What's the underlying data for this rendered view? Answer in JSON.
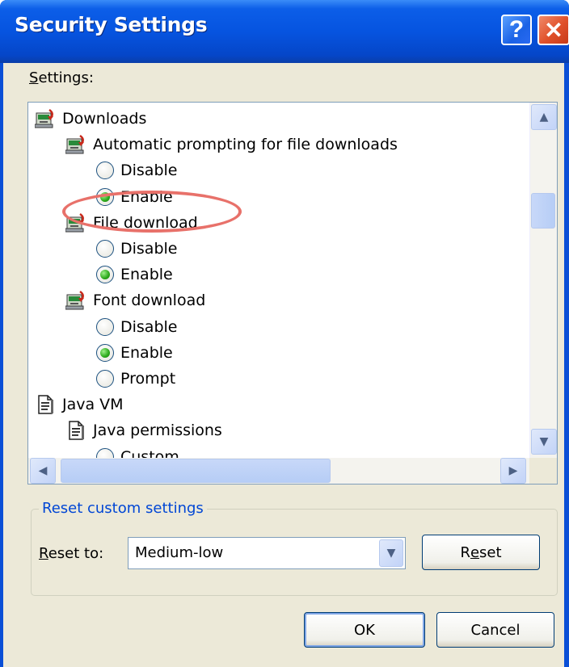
{
  "window": {
    "title": "Security Settings",
    "help_glyph": "?",
    "close_glyph": "✕",
    "accent": "#0a4fd6"
  },
  "settings": {
    "label_first": "S",
    "label_rest": "ettings:",
    "tree": [
      {
        "kind": "category",
        "level": 0,
        "icon": "downloads-icon",
        "label": "Downloads"
      },
      {
        "kind": "category",
        "level": 1,
        "icon": "downloads-icon",
        "label": "Automatic prompting for file downloads"
      },
      {
        "kind": "option",
        "level": 2,
        "label": "Disable",
        "checked": false
      },
      {
        "kind": "option",
        "level": 2,
        "label": "Enable",
        "checked": true
      },
      {
        "kind": "category",
        "level": 1,
        "icon": "downloads-icon",
        "label": "File download"
      },
      {
        "kind": "option",
        "level": 2,
        "label": "Disable",
        "checked": false
      },
      {
        "kind": "option",
        "level": 2,
        "label": "Enable",
        "checked": true
      },
      {
        "kind": "category",
        "level": 1,
        "icon": "downloads-icon",
        "label": "Font download"
      },
      {
        "kind": "option",
        "level": 2,
        "label": "Disable",
        "checked": false
      },
      {
        "kind": "option",
        "level": 2,
        "label": "Enable",
        "checked": true
      },
      {
        "kind": "option",
        "level": 2,
        "label": "Prompt",
        "checked": false
      },
      {
        "kind": "category",
        "level": 0,
        "icon": "document-icon",
        "label": "Java VM"
      },
      {
        "kind": "category",
        "level": 1,
        "icon": "document-icon",
        "label": "Java permissions"
      },
      {
        "kind": "option",
        "level": 2,
        "label": "Custom",
        "checked": false
      }
    ],
    "scroll": {
      "up": "▲",
      "down": "▼",
      "left": "◀",
      "right": "▶"
    },
    "highlight_color": "#e8716a"
  },
  "reset_group": {
    "title": "Reset custom settings",
    "reset_to_first": "R",
    "reset_to_rest": "eset to:",
    "selected": "Medium-low",
    "dropdown_arrow": "▼",
    "reset_button_pre": "R",
    "reset_button_u": "e",
    "reset_button_post": "set"
  },
  "buttons": {
    "ok": "OK",
    "cancel": "Cancel"
  }
}
